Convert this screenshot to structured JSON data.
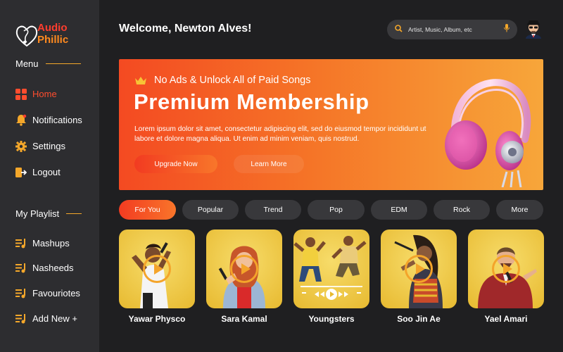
{
  "brand": {
    "line1": "Audio",
    "line2": "Phillic"
  },
  "sidebar": {
    "menu_title": "Menu",
    "menu_items": [
      {
        "label": "Home",
        "icon": "grid-icon",
        "active": true
      },
      {
        "label": "Notifications",
        "icon": "bell-icon"
      },
      {
        "label": "Settings",
        "icon": "gear-icon"
      },
      {
        "label": "Logout",
        "icon": "logout-icon"
      }
    ],
    "playlist_title": "My Playlist",
    "playlists": [
      {
        "label": "Mashups",
        "icon": "playlist-icon"
      },
      {
        "label": "Nasheeds",
        "icon": "playlist-icon"
      },
      {
        "label": "Favouriotes",
        "icon": "playlist-icon"
      },
      {
        "label": "Add New +",
        "icon": "playlist-icon"
      }
    ]
  },
  "header": {
    "welcome": "Welcome, Newton Alves!",
    "search_placeholder": "Artist, Music, Album, etc"
  },
  "banner": {
    "subtitle": "No Ads & Unlock All of Paid Songs",
    "title": "Premium Membership",
    "description": "Lorem ipsum dolor sit amet, consectetur adipiscing elit, sed do eiusmod tempor incididunt ut labore et dolore magna aliqua. Ut enim ad minim veniam, quis nostrud.",
    "upgrade_label": "Upgrade Now",
    "learn_label": "Learn More"
  },
  "tabs": [
    {
      "label": "For You",
      "active": true
    },
    {
      "label": "Popular"
    },
    {
      "label": "Trend"
    },
    {
      "label": "Pop"
    },
    {
      "label": "EDM"
    },
    {
      "label": "Rock"
    },
    {
      "label": "More"
    }
  ],
  "cards": [
    {
      "name": "Yawar Physco"
    },
    {
      "name": "Sara Kamal"
    },
    {
      "name": "Youngsters"
    },
    {
      "name": "Soo Jin Ae"
    },
    {
      "name": "Yael Amari"
    }
  ],
  "colors": {
    "accent": "#f44a22",
    "gold": "#f4a72a",
    "sidebar": "#2d2d30",
    "background": "#1f1f21"
  }
}
